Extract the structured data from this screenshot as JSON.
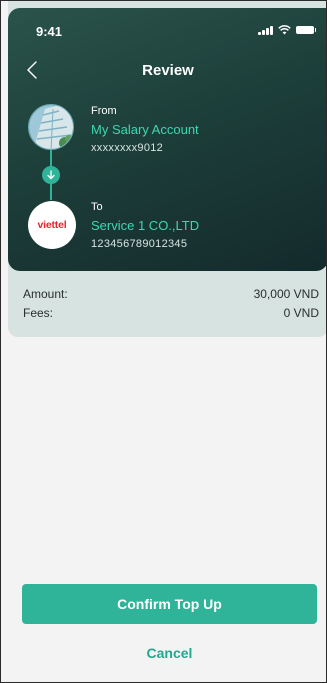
{
  "status_bar": {
    "time": "9:41",
    "signal_icon": "signal-icon",
    "wifi_icon": "wifi-icon",
    "battery_icon": "battery-icon"
  },
  "nav": {
    "back_icon": "chevron-left-icon",
    "title": "Review"
  },
  "from": {
    "label": "From",
    "name": "My Salary Account",
    "account": "xxxxxxxx9012",
    "avatar_icon": "building-photo"
  },
  "connector": {
    "icon": "arrow-down-icon"
  },
  "to": {
    "label": "To",
    "logo_text": "viettel",
    "name": "Service 1 CO.,LTD",
    "account": "123456789012345"
  },
  "summary": {
    "amount_label": "Amount:",
    "amount_value": "30,000 VND",
    "fees_label": "Fees:",
    "fees_value": "0 VND"
  },
  "actions": {
    "confirm_label": "Confirm Top Up",
    "cancel_label": "Cancel"
  },
  "colors": {
    "accent": "#2fb49a",
    "header_dark": "#1d3f3a",
    "summary_bg": "#d6e3e0",
    "logo_red": "#e4262c"
  }
}
